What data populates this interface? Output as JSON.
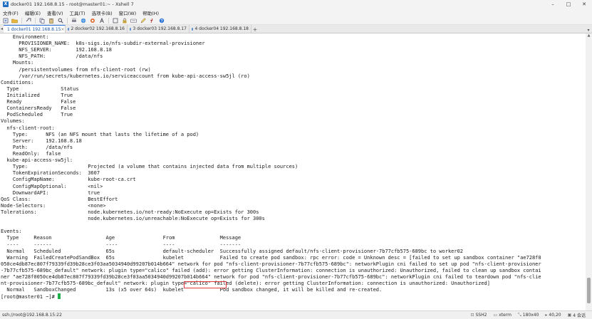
{
  "window": {
    "icon_letter": "X",
    "title": "docker01 192.168.8.15 - root@master01:~ - Xshell 7",
    "controls": [
      "–",
      "□",
      "✕"
    ]
  },
  "menu": [
    "文件(F)",
    "编辑(E)",
    "查看(V)",
    "工具(T)",
    "选项卡(B)",
    "窗口(W)",
    "帮助(H)"
  ],
  "toolbar": {
    "icons": [
      "new-session-icon",
      "open-folder-icon",
      "link-icon",
      "copy-icon",
      "paste-icon",
      "search-icon",
      "print-icon",
      "globe-icon",
      "color-scheme-icon",
      "font-icon",
      "fullscreen-icon",
      "lock-icon",
      "keyboard-icon",
      "compose-icon",
      "fx-icon",
      "help-icon"
    ]
  },
  "tabs": [
    {
      "label": "1 docker01 192.168.8.15",
      "active": true
    },
    {
      "label": "2 docker02 192.168.8.16",
      "active": false
    },
    {
      "label": "3 docker03 192.168.8.17",
      "active": false
    },
    {
      "label": "4 docker04 192.168.8.18",
      "active": false
    }
  ],
  "terminal": {
    "lines": [
      "    Environment:",
      "      PROVISIONER_NAME:  k8s-sigs.io/nfs-subdir-external-provisioner",
      "      NFS_SERVER:        192.168.8.18",
      "      NFS_PATH:          /data/nfs",
      "    Mounts:",
      "      /persistentvolumes from nfs-client-root (rw)",
      "      /var/run/secrets/kubernetes.io/serviceaccount from kube-api-access-sw5jl (ro)",
      "Conditions:",
      "  Type              Status",
      "  Initialized       True",
      "  Ready             False",
      "  ContainersReady   False",
      "  PodScheduled      True",
      "Volumes:",
      "  nfs-client-root:",
      "    Type:      NFS (an NFS mount that lasts the lifetime of a pod)",
      "    Server:    192.168.8.18",
      "    Path:      /data/nfs",
      "    ReadOnly:  false",
      "  kube-api-access-sw5jl:",
      "    Type:                    Projected (a volume that contains injected data from multiple sources)",
      "    TokenExpirationSeconds:  3607",
      "    ConfigMapName:           kube-root-ca.crt",
      "    ConfigMapOptional:       <nil>",
      "    DownwardAPI:             true",
      "QoS Class:                   BestEffort",
      "Node-Selectors:              <none>",
      "Tolerations:                 node.kubernetes.io/not-ready:NoExecute op=Exists for 300s",
      "                             node.kubernetes.io/unreachable:NoExecute op=Exists for 300s",
      "",
      "Events:",
      "  Type     Reason                  Age                From               Message",
      "  ----     ------                  ----               ----               -------",
      "  Normal   Scheduled               65s                default-scheduler  Successfully assigned default/nfs-client-provisioner-7b77cfb575-689bc to worker02",
      "  Warning  FailedCreatePodSandBox  65s                kubelet            Failed to create pod sandbox: rpc error: code = Unknown desc = [failed to set up sandbox container \"ae728f0",
      "050ce4db87ec807f79339fd39b28ce3f03aa5034940d99207b014b664\" network for pod \"nfs-client-provisioner-7b77cfb575-689bc\": networkPlugin cni failed to set up pod \"nfs-client-provisioner",
      "-7b77cfb575-689bc_default\" network: plugin type=\"calico\" failed (add): error getting ClusterInformation: connection is unauthorized: Unauthorized, failed to clean up sandbox contai",
      "ner \"ae728f0050ce4db87ec807f79339fd39b28ce3f03aa5034940d99207b014b664\" network for pod \"nfs-client-provisioner-7b77cfb575-689bc\": networkPlugin cni failed to teardown pod \"nfs-clie",
      "nt-provisioner-7b77cfb575-689bc_default\" network: plugin type=\"calico\" failed (delete): error getting ClusterInformation: connection is unauthorized: Unauthorized]",
      "  Normal   SandboxChanged          13s (x5 over 64s)  kubelet            Pod sandbox changed, it will be killed and re-created."
    ],
    "prompt": "[root@master01 ~]# "
  },
  "status": {
    "connection": "ssh://root@192.168.8.15:22",
    "protocol": "SSH2",
    "terminal_type": "xterm",
    "size": "180x40",
    "position": "40,20",
    "sessions": "4 会话"
  },
  "colors": {
    "cursor": "#21b04a",
    "highlight_border": "#e23b3b",
    "active_tab_text": "#1a56a8"
  }
}
